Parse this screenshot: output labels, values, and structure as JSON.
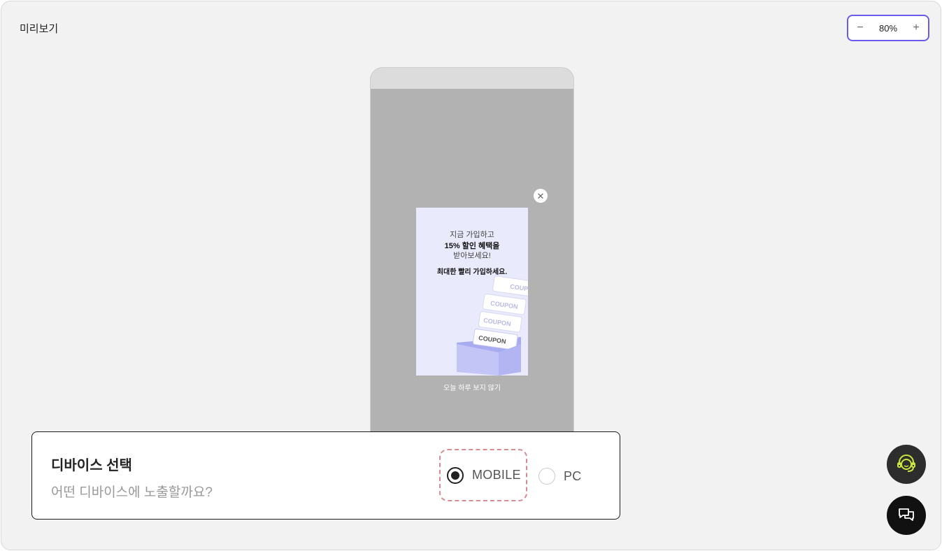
{
  "header": {
    "title": "미리보기"
  },
  "zoom": {
    "minus": "−",
    "value": "80%",
    "plus": "+"
  },
  "popup": {
    "close_symbol": "✕",
    "line1": "지금 가입하고",
    "line2": "15% 할인 혜택을",
    "line3": "받아보세요!",
    "line4": "최대한 빨리 가입하세요.",
    "coupon_text": "COUPON",
    "dismiss": "오늘 하루 보지 않기"
  },
  "device_panel": {
    "title": "디바이스 선택",
    "subtitle": "어떤 디바이스에 노출할까요?",
    "options": [
      {
        "label": "MOBILE",
        "selected": true
      },
      {
        "label": "PC",
        "selected": false
      }
    ]
  },
  "colors": {
    "accent": "#6b5ce7",
    "highlight_dash": "#d98a92",
    "support_icon": "#c8e63c"
  },
  "icons": {
    "support": "headset-icon",
    "chat": "chat-bubbles-icon",
    "close": "close-icon"
  }
}
